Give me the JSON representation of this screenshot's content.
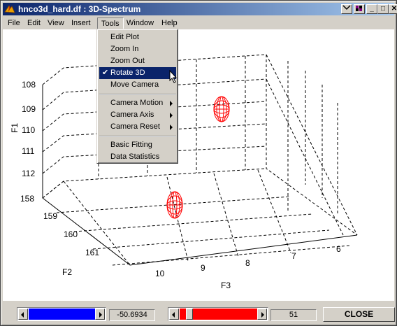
{
  "window": {
    "title": "hnco3d_hard.df : 3D-Spectrum",
    "minimize_label": "_",
    "maximize_label": "□",
    "close_label": "✕"
  },
  "menubar": [
    {
      "label": "File"
    },
    {
      "label": "Edit"
    },
    {
      "label": "View"
    },
    {
      "label": "Insert"
    },
    {
      "label": "Tools"
    },
    {
      "label": "Window"
    },
    {
      "label": "Help"
    }
  ],
  "tools_menu": {
    "items": [
      {
        "label": "Edit Plot"
      },
      {
        "label": "Zoom In"
      },
      {
        "label": "Zoom Out"
      },
      {
        "label": "Rotate 3D",
        "checked": true,
        "highlighted": true
      },
      {
        "label": "Move Camera"
      },
      {
        "label": "Camera Motion",
        "submenu": true
      },
      {
        "label": "Camera Axis",
        "submenu": true
      },
      {
        "label": "Camera Reset",
        "submenu": true
      },
      {
        "label": "Basic Fitting"
      },
      {
        "label": "Data Statistics"
      }
    ]
  },
  "plot": {
    "f1_label": "F1",
    "f1_ticks": [
      "108",
      "109",
      "110",
      "111",
      "112"
    ],
    "f2_label": "F2",
    "f2_ticks": [
      "158",
      "159",
      "160",
      "161"
    ],
    "f3_label": "F3",
    "f3_ticks": [
      "10",
      "9",
      "8",
      "7",
      "6"
    ],
    "peak_color": "#ff0000"
  },
  "controls": {
    "left_slider_color": "#0000ff",
    "left_value": "-50.6934",
    "right_slider_color": "#ff0000",
    "right_value": "51",
    "close_label": "CLOSE"
  }
}
